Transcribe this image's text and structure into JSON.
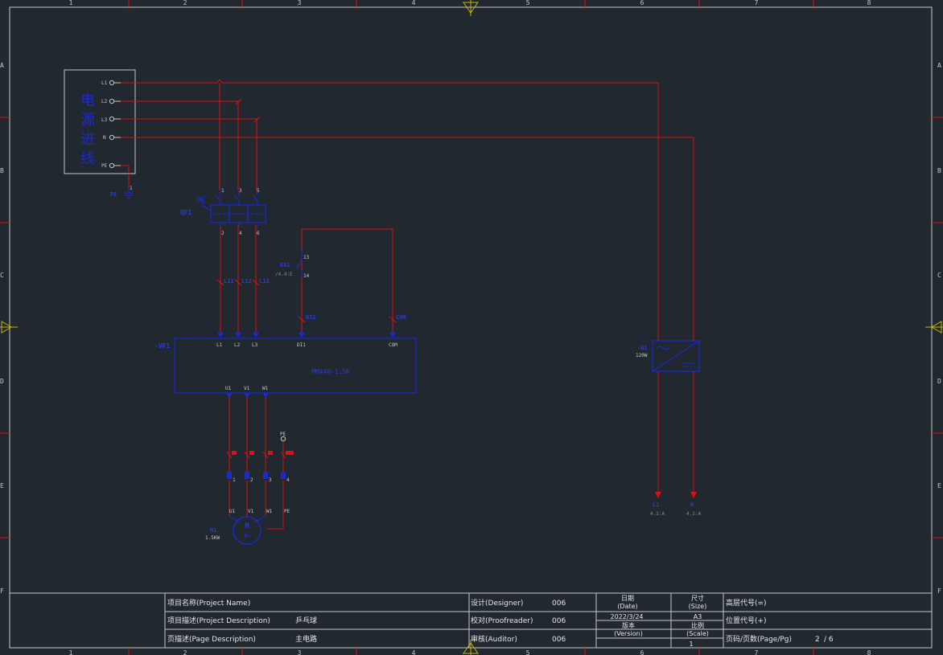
{
  "colors": {
    "background": "#212830",
    "frame": "#c8c8c8",
    "wire": "#e01010",
    "component": "#1a2ad0",
    "tag": "#2a3ae0",
    "text": "#e6e6e6",
    "dim": "#8a8a8a"
  },
  "grid": {
    "columns": [
      "1",
      "2",
      "3",
      "4",
      "5",
      "6",
      "7",
      "8"
    ],
    "rows": [
      "A",
      "B",
      "C",
      "D",
      "E",
      "F"
    ]
  },
  "power_input": {
    "title_chars": [
      "电",
      "源",
      "进",
      "线"
    ],
    "terminals": [
      "L1",
      "L2",
      "L3",
      "N",
      "PE"
    ],
    "pe_terminal_number": "1",
    "pe_tag": "PE"
  },
  "breaker": {
    "tag": "QF1",
    "top_terminals": [
      "1",
      "3",
      "5"
    ],
    "bottom_terminals": [
      "2",
      "4",
      "6"
    ]
  },
  "wire_labels": {
    "l1": "L11",
    "l2": "L12",
    "l3": "L13",
    "di1": "DI1",
    "com": "COM"
  },
  "aux_contact": {
    "tag": "KA1",
    "terminal_top": "13",
    "terminal_bottom": "14",
    "reference": "/4.4:E"
  },
  "inverter": {
    "tag": "-VF1",
    "model": "MM440-1.5K",
    "inputs": [
      "L1",
      "L2",
      "L3",
      "DI1",
      "COM"
    ],
    "outputs": [
      "U1",
      "V1",
      "W1"
    ]
  },
  "motor_terminals": {
    "pe_label": "PE",
    "numbers": [
      "1",
      "2",
      "3",
      "4"
    ],
    "labels": [
      "U1",
      "V1",
      "W1",
      "PE"
    ]
  },
  "motor": {
    "tag": "M1",
    "power": "1.5KW",
    "symbol": "M",
    "phase": "3~"
  },
  "psu": {
    "tag": "-G1",
    "power": "120W"
  },
  "page_refs": [
    {
      "tag": "L1",
      "ref": "4.2:A"
    },
    {
      "tag": "N",
      "ref": "4.2:A"
    }
  ],
  "title_block": {
    "project_name_label": "项目名称(Project Name)",
    "project_name_value": "",
    "project_desc_label": "项目描述(Project Description)",
    "project_desc_value": "乒乓球",
    "page_desc_label": "页描述(Page Description)",
    "page_desc_value": "主电路",
    "designer_label": "设计(Designer)",
    "designer_value": "006",
    "proofreader_label": "校对(Proofreader)",
    "proofreader_value": "006",
    "auditor_label": "审核(Auditor)",
    "auditor_value": "006",
    "date_label_cn": "日期",
    "date_label_en": "(Date)",
    "date_value": "2022/3/24",
    "version_label_cn": "版本",
    "version_label_en": "(Version)",
    "size_label_cn": "尺寸",
    "size_label_en": "(Size)",
    "size_value": "A3",
    "scale_label_cn": "比例",
    "scale_label_en": "(Scale)",
    "scale_value": "1",
    "higher_code_label": "高层代号(=)",
    "location_code_label": "位置代号(+)",
    "page_label": "页码/页数(Page/Pg)",
    "page_current": "2",
    "page_total": "/ 6"
  }
}
